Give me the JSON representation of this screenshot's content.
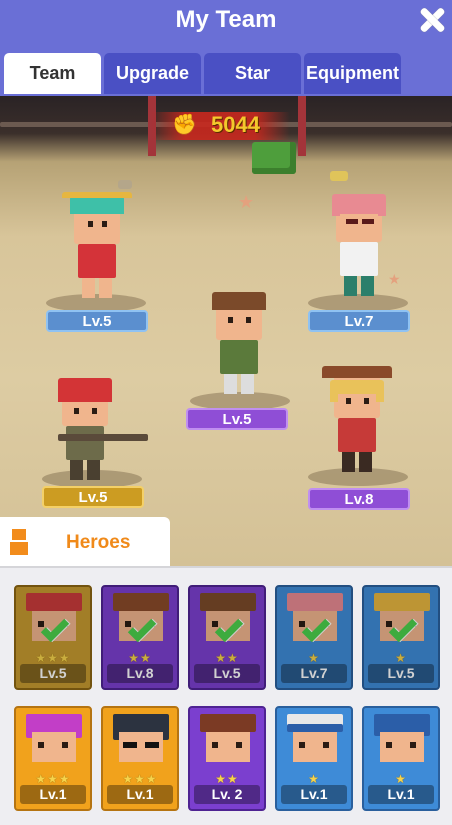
{
  "header": {
    "title": "My Team"
  },
  "tabs": [
    {
      "label": "Team",
      "active": true
    },
    {
      "label": "Upgrade",
      "active": false
    },
    {
      "label": "Star",
      "active": false
    },
    {
      "label": "Equipment",
      "active": false
    }
  ],
  "arena": {
    "power": "5044",
    "team": [
      {
        "name": "green-hair-hero",
        "level": "Lv.5",
        "pill": "blue"
      },
      {
        "name": "pink-hair-hero",
        "level": "Lv.7",
        "pill": "blue"
      },
      {
        "name": "bandana-hero",
        "level": "Lv.5",
        "pill": "purple"
      },
      {
        "name": "red-hair-gunner-hero",
        "level": "Lv.5",
        "pill": "gold"
      },
      {
        "name": "cowboy-hero",
        "level": "Lv.8",
        "pill": "purple"
      }
    ]
  },
  "heroes_section": {
    "label": "Heroes"
  },
  "hero_cards": [
    {
      "level": "Lv.5",
      "stars": "★★★",
      "rarity": "gold",
      "in_team": true
    },
    {
      "level": "Lv.8",
      "stars": "★★",
      "rarity": "purple",
      "in_team": true
    },
    {
      "level": "Lv.5",
      "stars": "★★",
      "rarity": "purple",
      "in_team": true
    },
    {
      "level": "Lv.7",
      "stars": "★",
      "rarity": "blue",
      "in_team": true
    },
    {
      "level": "Lv.5",
      "stars": "★",
      "rarity": "blue",
      "in_team": true
    },
    {
      "level": "Lv.1",
      "stars": "★★★",
      "rarity": "orange",
      "in_team": false
    },
    {
      "level": "Lv.1",
      "stars": "★★★",
      "rarity": "orange",
      "in_team": false
    },
    {
      "level": "Lv. 2",
      "stars": "★★",
      "rarity": "purple",
      "in_team": false
    },
    {
      "level": "Lv.1",
      "stars": "★",
      "rarity": "blue",
      "in_team": false
    },
    {
      "level": "Lv.1",
      "stars": "★",
      "rarity": "blue",
      "in_team": false
    }
  ]
}
